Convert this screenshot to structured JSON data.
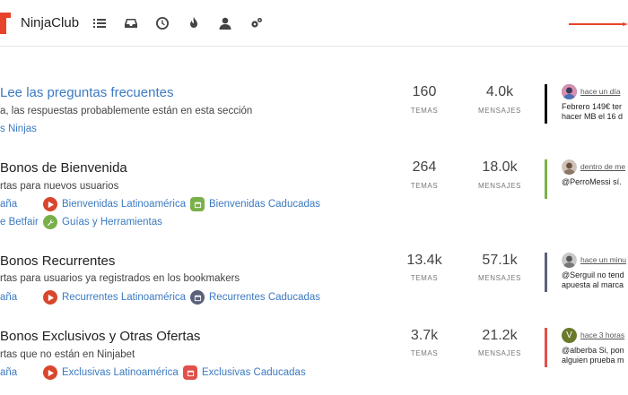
{
  "header": {
    "brand": "NinjaClub",
    "logo_color": "#e8432a",
    "nav_icons": [
      "list-icon",
      "inbox-icon",
      "clock-icon",
      "fire-icon",
      "user-icon",
      "gears-icon"
    ]
  },
  "categories": [
    {
      "title": "Lee las preguntas frecuentes",
      "description": "a, las respuestas probablemente están en esta sección",
      "subcategories": [
        {
          "label": "s Ninjas",
          "icon": "",
          "color": ""
        }
      ],
      "topics": "160",
      "topics_label": "TEMAS",
      "posts": "4.0k",
      "posts_label": "MENSAJES",
      "latest": {
        "time": "hace un día",
        "line1": "Febrero 149€ ter",
        "line2": "hacer MB el 16 d",
        "bar_color": "#111111",
        "avatar": ""
      }
    },
    {
      "title": "Bonos de Bienvenida",
      "description": "rtas para nuevos usuarios",
      "subcategories": [
        {
          "label": "aña",
          "icon": "",
          "color": ""
        },
        {
          "label": "Bienvenidas Latinoamérica",
          "icon": "play-icon",
          "color": "#d9462c"
        },
        {
          "label": "Bienvenidas Caducadas",
          "icon": "calendar-icon",
          "color": "#7ab04a"
        },
        {
          "label": "e Betfair",
          "icon": "",
          "color": ""
        },
        {
          "label": "Guías y Herramientas",
          "icon": "wrench-icon",
          "color": "#7ab04a"
        }
      ],
      "topics": "264",
      "topics_label": "TEMAS",
      "posts": "18.0k",
      "posts_label": "MENSAJES",
      "latest": {
        "time": "dentro de me",
        "line1": "@PerroMessi sí.",
        "line2": "",
        "bar_color": "#7ab04a",
        "avatar": ""
      }
    },
    {
      "title": "Bonos Recurrentes",
      "description": "rtas para usuarios ya registrados en los bookmakers",
      "subcategories": [
        {
          "label": "aña",
          "icon": "",
          "color": ""
        },
        {
          "label": "Recurrentes Latinoamérica",
          "icon": "play-icon",
          "color": "#d9462c"
        },
        {
          "label": "Recurrentes Caducadas",
          "icon": "calendar-icon",
          "color": "#5a6178"
        }
      ],
      "topics": "13.4k",
      "topics_label": "TEMAS",
      "posts": "57.1k",
      "posts_label": "MENSAJES",
      "latest": {
        "time": "hace un minu",
        "line1": "@Serguil no tend",
        "line2": "apuesta al marca",
        "bar_color": "#5a6178",
        "avatar": ""
      }
    },
    {
      "title": "Bonos Exclusivos y Otras Ofertas",
      "description": "rtas que no están en Ninjabet",
      "subcategories": [
        {
          "label": "aña",
          "icon": "",
          "color": ""
        },
        {
          "label": "Exclusivas Latinoamérica",
          "icon": "play-icon",
          "color": "#d9462c"
        },
        {
          "label": "Exclusivas Caducadas",
          "icon": "calendar-icon",
          "color": "#e0504a"
        }
      ],
      "topics": "3.7k",
      "topics_label": "TEMAS",
      "posts": "21.2k",
      "posts_label": "MENSAJES",
      "latest": {
        "time": "hace 3 horas",
        "line1": "@alberba Si, pon",
        "line2": "alguien prueba m",
        "bar_color": "#e0504a",
        "avatar": "V"
      }
    }
  ]
}
